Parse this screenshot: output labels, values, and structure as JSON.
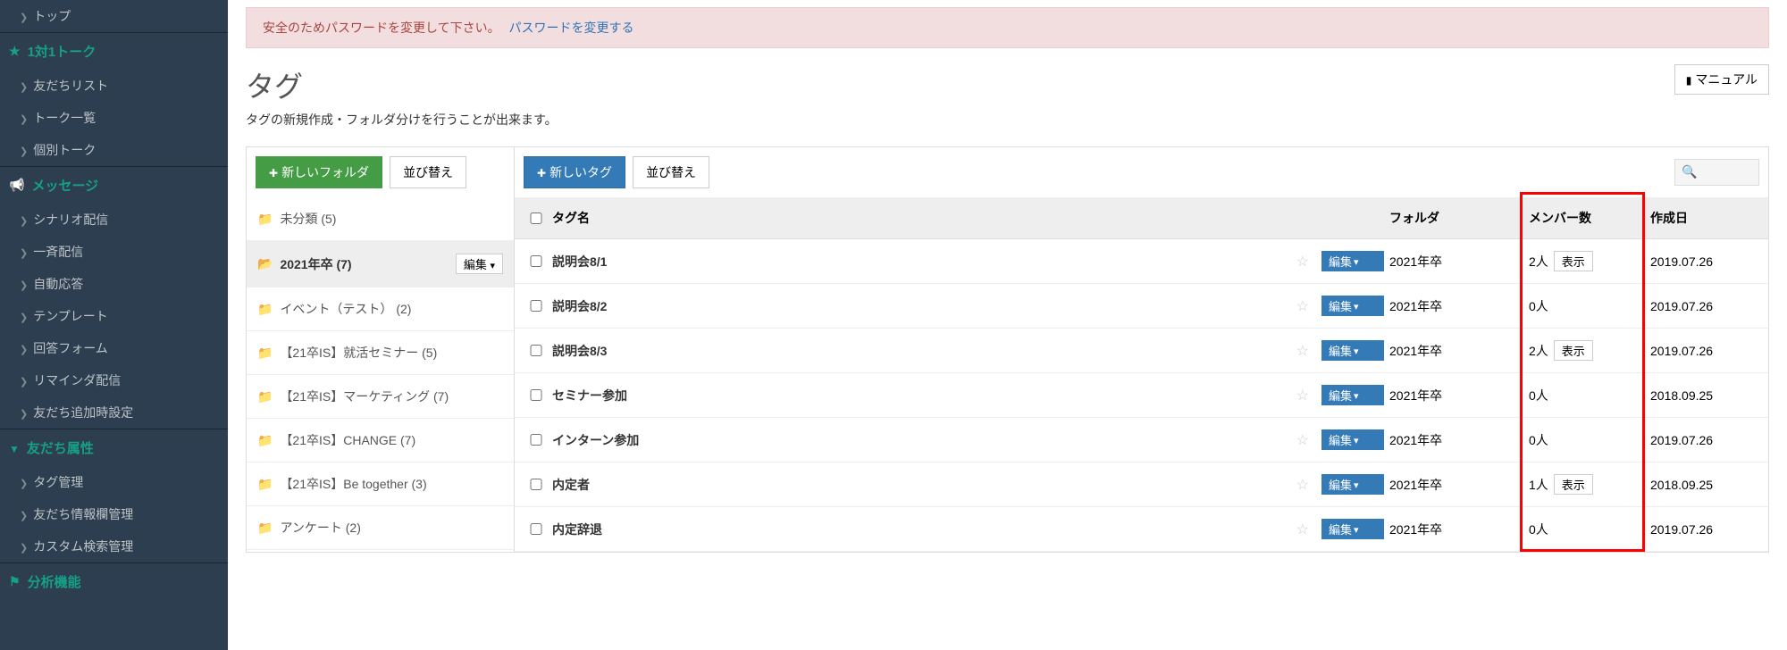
{
  "sidebar": {
    "top": "トップ",
    "section1": {
      "label": "1対1トーク",
      "items": [
        "友だちリスト",
        "トーク一覧",
        "個別トーク"
      ]
    },
    "section2": {
      "label": "メッセージ",
      "items": [
        "シナリオ配信",
        "一斉配信",
        "自動応答",
        "テンプレート",
        "回答フォーム",
        "リマインダ配信",
        "友だち追加時設定"
      ]
    },
    "section3": {
      "label": "友だち属性",
      "items": [
        "タグ管理",
        "友だち情報欄管理",
        "カスタム検索管理"
      ]
    },
    "section4": {
      "label": "分析機能",
      "items": []
    }
  },
  "alert": {
    "text": "安全のためパスワードを変更して下さい。",
    "link": "パスワードを変更する"
  },
  "page": {
    "title": "タグ",
    "subtitle": "タグの新規作成・フォルダ分けを行うことが出来ます。",
    "manual": "マニュアル"
  },
  "toolbar": {
    "newFolder": "新しいフォルダ",
    "sortFolder": "並び替え",
    "newTag": "新しいタグ",
    "sortTag": "並び替え"
  },
  "columns": {
    "tagName": "タグ名",
    "folder": "フォルダ",
    "memberCount": "メンバー数",
    "created": "作成日"
  },
  "editLabel": "編集",
  "showLabel": "表示",
  "peopleSuffix": "人",
  "folders": [
    {
      "label": "未分類 (5)",
      "active": false
    },
    {
      "label": "2021年卒 (7)",
      "active": true
    },
    {
      "label": "イベント（テスト） (2)",
      "active": false
    },
    {
      "label": "【21卒IS】就活セミナー (5)",
      "active": false
    },
    {
      "label": "【21卒IS】マーケティング (7)",
      "active": false
    },
    {
      "label": "【21卒IS】CHANGE (7)",
      "active": false
    },
    {
      "label": "【21卒IS】Be together (3)",
      "active": false
    },
    {
      "label": "アンケート (2)",
      "active": false
    }
  ],
  "tags": [
    {
      "name": "説明会8/1",
      "folder": "2021年卒",
      "members": 2,
      "showBtn": true,
      "created": "2019.07.26"
    },
    {
      "name": "説明会8/2",
      "folder": "2021年卒",
      "members": 0,
      "showBtn": false,
      "created": "2019.07.26"
    },
    {
      "name": "説明会8/3",
      "folder": "2021年卒",
      "members": 2,
      "showBtn": true,
      "created": "2019.07.26"
    },
    {
      "name": "セミナー参加",
      "folder": "2021年卒",
      "members": 0,
      "showBtn": false,
      "created": "2018.09.25"
    },
    {
      "name": "インターン参加",
      "folder": "2021年卒",
      "members": 0,
      "showBtn": false,
      "created": "2019.07.26"
    },
    {
      "name": "内定者",
      "folder": "2021年卒",
      "members": 1,
      "showBtn": true,
      "created": "2018.09.25"
    },
    {
      "name": "内定辞退",
      "folder": "2021年卒",
      "members": 0,
      "showBtn": false,
      "created": "2019.07.26"
    }
  ]
}
